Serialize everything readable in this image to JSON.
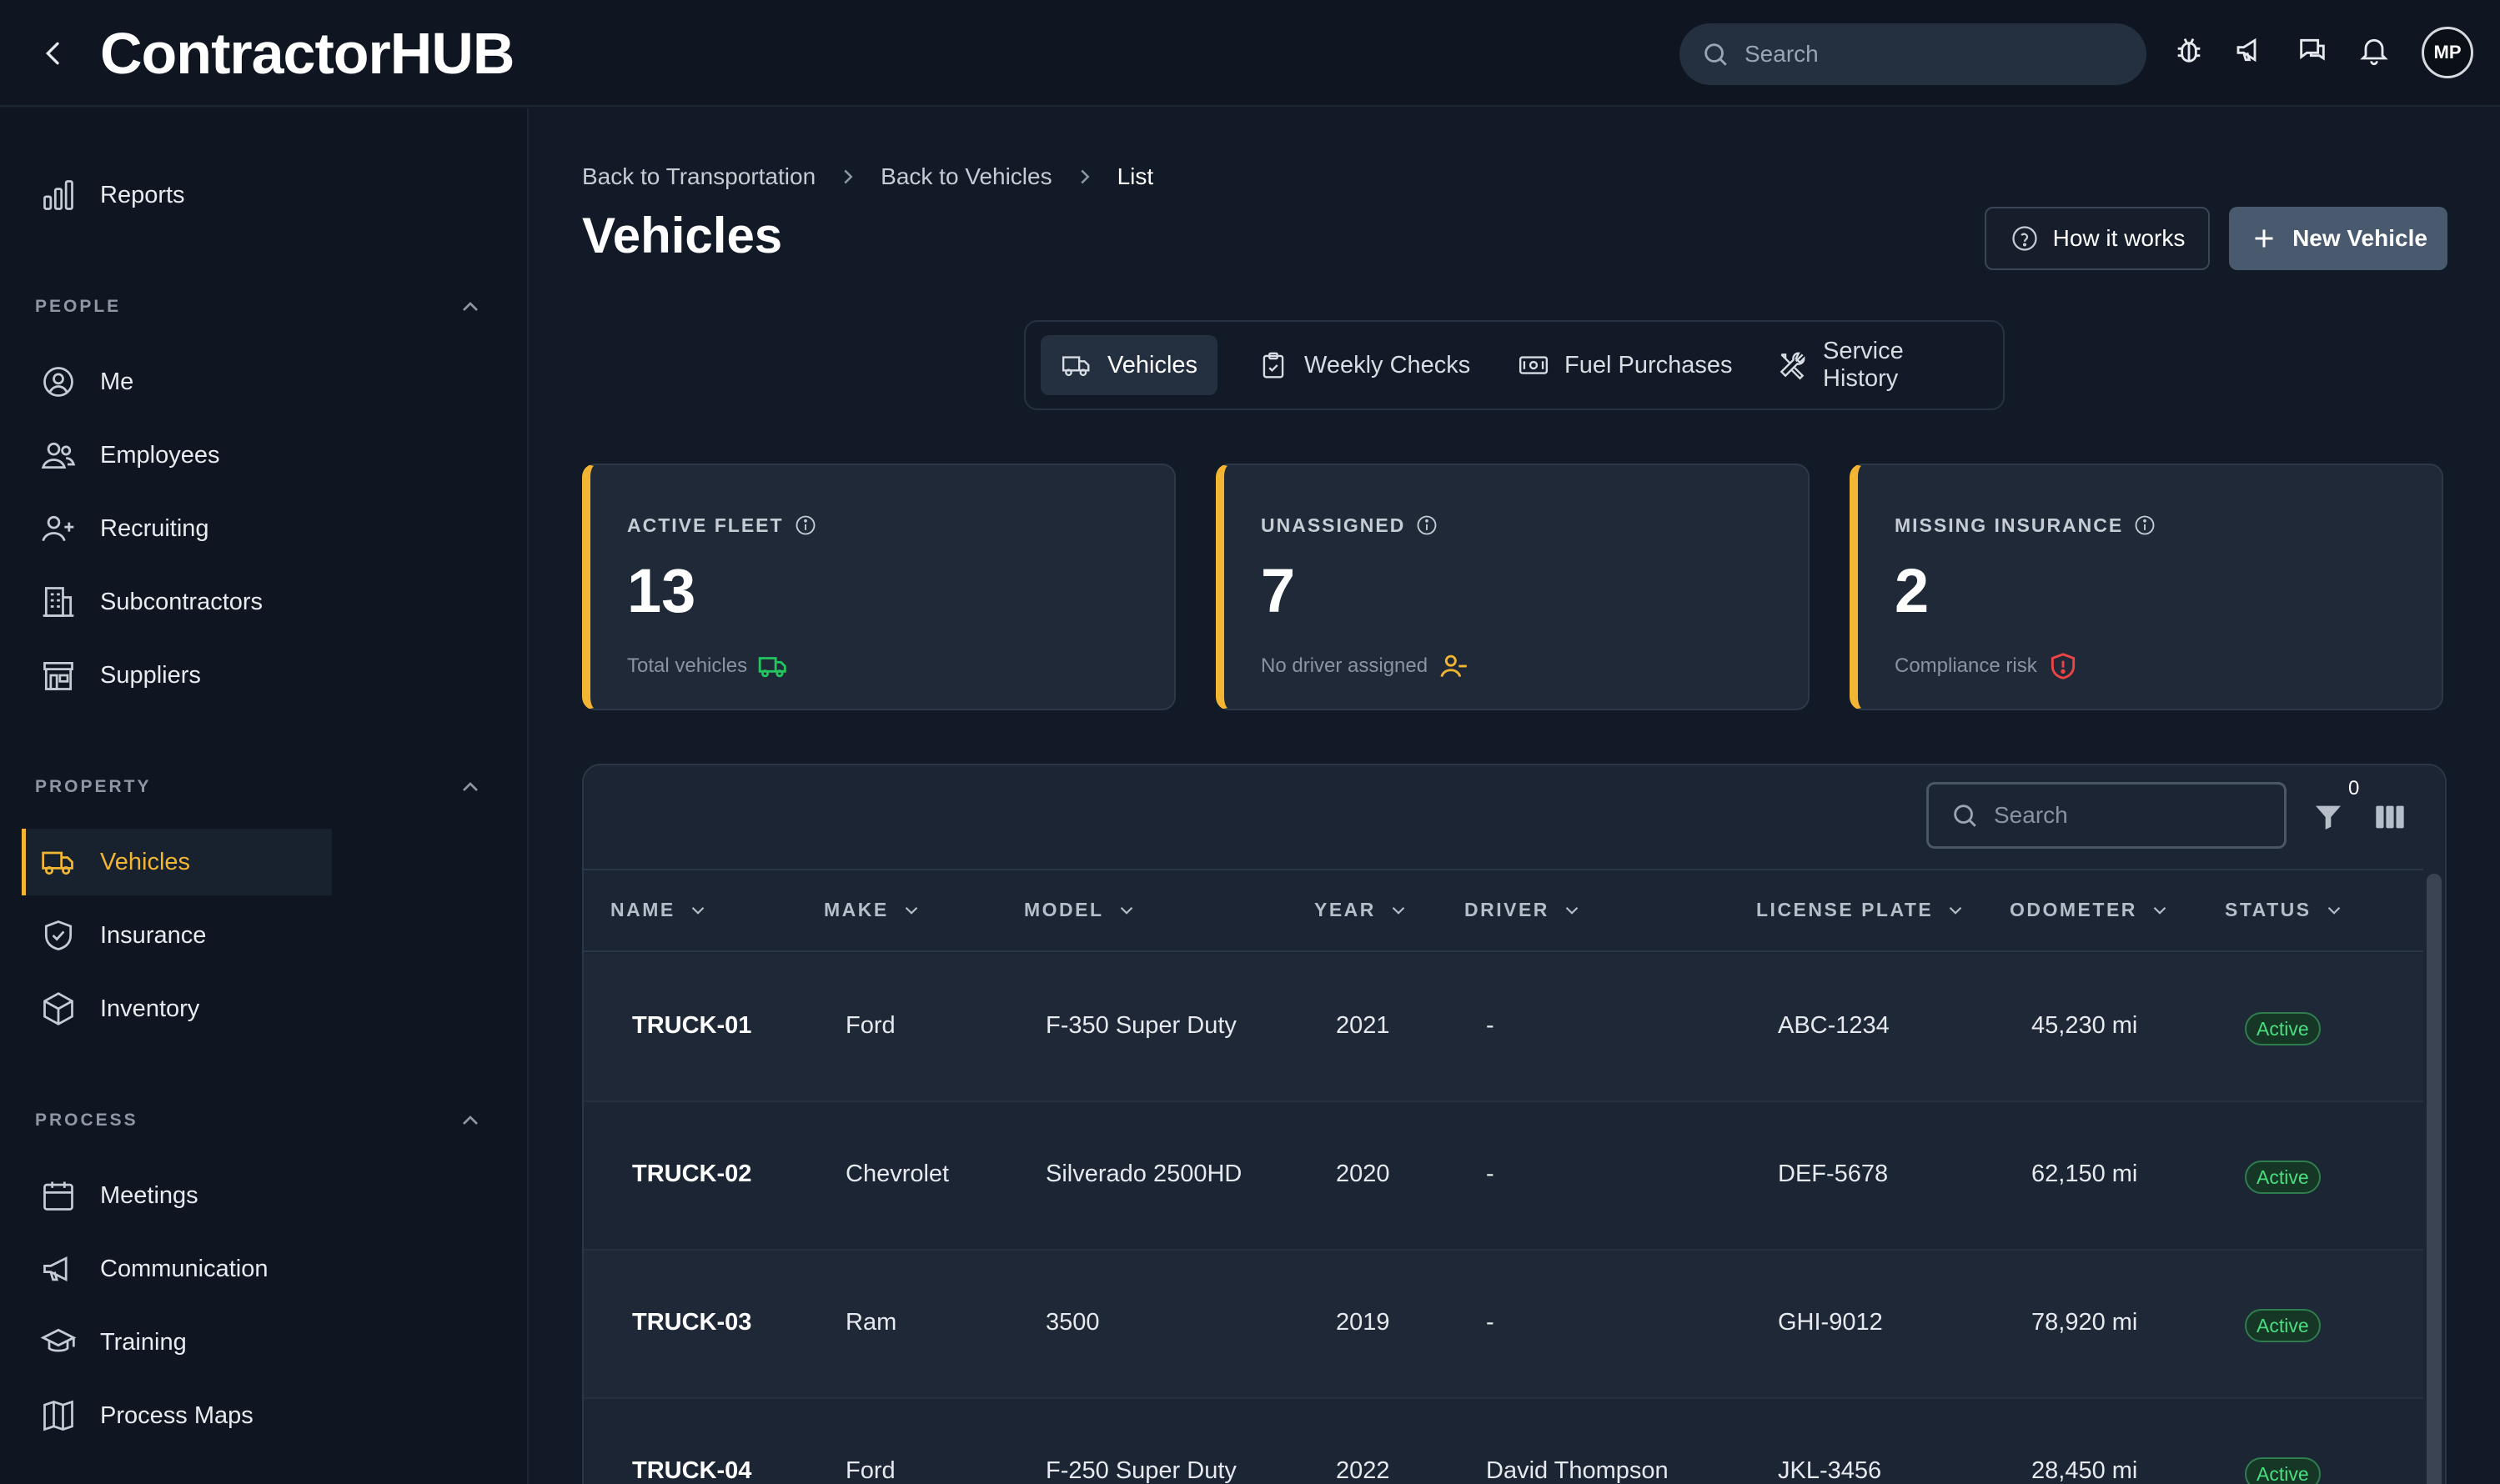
{
  "app": {
    "logo_text": "ContractorHUB",
    "search_placeholder": "Search",
    "avatar_initials": "MP"
  },
  "sidebar": {
    "reports": "Reports",
    "people_title": "PEOPLE",
    "people": [
      "Me",
      "Employees",
      "Recruiting",
      "Subcontractors",
      "Suppliers"
    ],
    "property_title": "PROPERTY",
    "property": [
      "Vehicles",
      "Insurance",
      "Inventory"
    ],
    "process_title": "PROCESS",
    "process": [
      "Meetings",
      "Communication",
      "Training",
      "Process Maps"
    ],
    "active_item": "Vehicles"
  },
  "breadcrumb": [
    "Back to Transportation",
    "Back to Vehicles",
    "List"
  ],
  "page": {
    "title": "Vehicles",
    "how_it_works": "How it works",
    "new_vehicle": "New Vehicle"
  },
  "tabs": [
    "Vehicles",
    "Weekly Checks",
    "Fuel Purchases",
    "Service History"
  ],
  "kpis": [
    {
      "label": "ACTIVE FLEET",
      "value": "13",
      "sub": "Total vehicles",
      "icon": "truck-icon",
      "icon_color": "#22c55e"
    },
    {
      "label": "UNASSIGNED",
      "value": "7",
      "sub": "No driver assigned",
      "icon": "user-minus-icon",
      "icon_color": "#f2b632"
    },
    {
      "label": "MISSING INSURANCE",
      "value": "2",
      "sub": "Compliance risk",
      "icon": "shield-alert-icon",
      "icon_color": "#ef4444"
    }
  ],
  "table": {
    "search_placeholder": "Search",
    "filter_count": "0",
    "columns": [
      "NAME",
      "MAKE",
      "MODEL",
      "YEAR",
      "DRIVER",
      "LICENSE PLATE",
      "ODOMETER",
      "STATUS"
    ],
    "rows": [
      {
        "name": "TRUCK-01",
        "make": "Ford",
        "model": "F-350 Super Duty",
        "year": "2021",
        "driver": "-",
        "plate": "ABC-1234",
        "odometer": "45,230 mi",
        "status": "Active"
      },
      {
        "name": "TRUCK-02",
        "make": "Chevrolet",
        "model": "Silverado 2500HD",
        "year": "2020",
        "driver": "-",
        "plate": "DEF-5678",
        "odometer": "62,150 mi",
        "status": "Active"
      },
      {
        "name": "TRUCK-03",
        "make": "Ram",
        "model": "3500",
        "year": "2019",
        "driver": "-",
        "plate": "GHI-9012",
        "odometer": "78,920 mi",
        "status": "Active"
      },
      {
        "name": "TRUCK-04",
        "make": "Ford",
        "model": "F-250 Super Duty",
        "year": "2022",
        "driver": "David Thompson",
        "plate": "JKL-3456",
        "odometer": "28,450 mi",
        "status": "Active"
      }
    ]
  },
  "colors": {
    "accent": "#f2b632",
    "status_active": "#4ade80"
  }
}
